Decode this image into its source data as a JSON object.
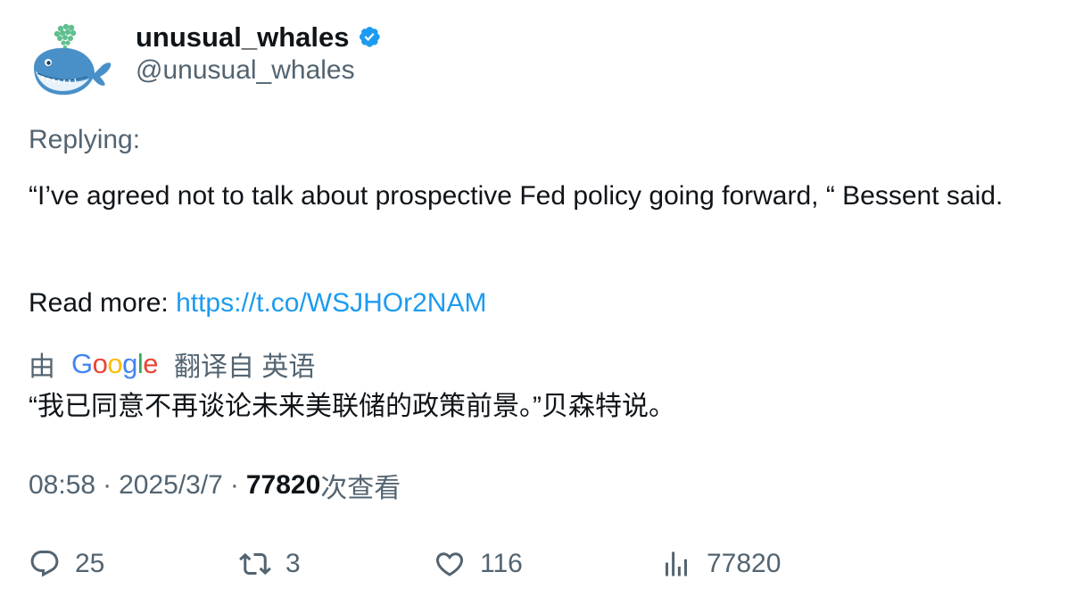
{
  "author": {
    "display_name": "unusual_whales",
    "handle": "@unusual_whales",
    "avatar_icon": "whale-avatar-icon",
    "verified_icon": "verified-badge-icon",
    "verified_color": "#1d9bf0"
  },
  "tweet": {
    "replying_label": "Replying:",
    "text": "“I’ve agreed not to talk about prospective Fed policy going forward, “ Bessent said.",
    "read_more_label": "Read more: ",
    "link": "https://t.co/WSJHOr2NAM"
  },
  "translation": {
    "prefix": "由",
    "provider": "Google",
    "label": "翻译自 英语",
    "text": "“我已同意不再谈论未来美联储的政策前景。”贝森特说。"
  },
  "meta": {
    "time": "08:58",
    "separator": "·",
    "date": "2025/3/7",
    "views_count": "77820",
    "views_label": "次查看"
  },
  "actions": {
    "replies": "25",
    "reposts": "3",
    "likes": "116",
    "views": "77820"
  },
  "colors": {
    "text_primary": "#0f1419",
    "text_secondary": "#536471",
    "link": "#1d9bf0"
  }
}
